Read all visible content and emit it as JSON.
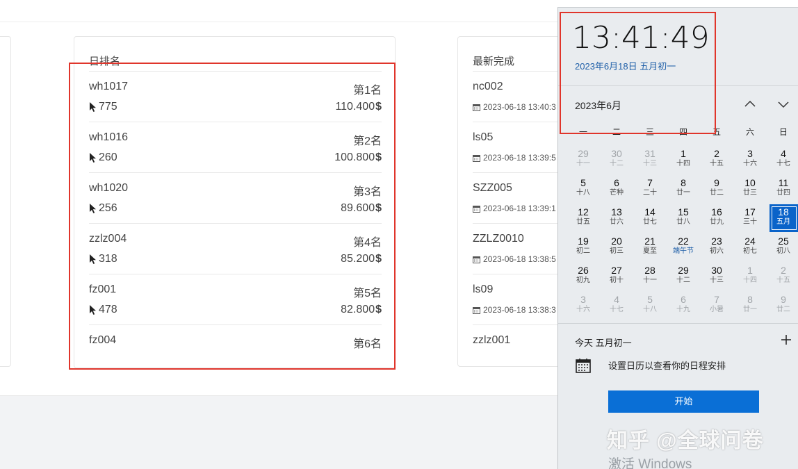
{
  "rank_card": {
    "title": "日排名",
    "items": [
      {
        "name": "wh1017",
        "place": "第1名",
        "clicks": "775",
        "amount": "110.400"
      },
      {
        "name": "wh1016",
        "place": "第2名",
        "clicks": "260",
        "amount": "100.800"
      },
      {
        "name": "wh1020",
        "place": "第3名",
        "clicks": "256",
        "amount": "89.600"
      },
      {
        "name": "zzlz004",
        "place": "第4名",
        "clicks": "318",
        "amount": "85.200"
      },
      {
        "name": "fz001",
        "place": "第5名",
        "clicks": "478",
        "amount": "82.800"
      },
      {
        "name": "fz004",
        "place": "第6名"
      }
    ],
    "currency_symbol": "$"
  },
  "latest_card": {
    "title": "最新完成",
    "items": [
      {
        "name": "nc002",
        "time": "2023-06-18 13:40:3"
      },
      {
        "name": "ls05",
        "time": "2023-06-18 13:39:5"
      },
      {
        "name": "SZZ005",
        "time": "2023-06-18 13:39:1"
      },
      {
        "name": "ZZLZ0010",
        "time": "2023-06-18 13:38:5"
      },
      {
        "name": "ls09",
        "time": "2023-06-18 13:38:3"
      },
      {
        "name": "zzlz001"
      }
    ]
  },
  "calendar": {
    "time": "13:41:49",
    "date": "2023年6月18日 五月初一",
    "month": "2023年6月",
    "weekdays": [
      "一",
      "二",
      "三",
      "四",
      "五",
      "六",
      "日"
    ],
    "days": [
      {
        "d": "29",
        "l": "十一",
        "other": true
      },
      {
        "d": "30",
        "l": "十二",
        "other": true
      },
      {
        "d": "31",
        "l": "十三",
        "other": true
      },
      {
        "d": "1",
        "l": "十四"
      },
      {
        "d": "2",
        "l": "十五"
      },
      {
        "d": "3",
        "l": "十六"
      },
      {
        "d": "4",
        "l": "十七"
      },
      {
        "d": "5",
        "l": "十八"
      },
      {
        "d": "6",
        "l": "芒种"
      },
      {
        "d": "7",
        "l": "二十"
      },
      {
        "d": "8",
        "l": "廿一"
      },
      {
        "d": "9",
        "l": "廿二"
      },
      {
        "d": "10",
        "l": "廿三"
      },
      {
        "d": "11",
        "l": "廿四"
      },
      {
        "d": "12",
        "l": "廿五"
      },
      {
        "d": "13",
        "l": "廿六"
      },
      {
        "d": "14",
        "l": "廿七"
      },
      {
        "d": "15",
        "l": "廿八"
      },
      {
        "d": "16",
        "l": "廿九"
      },
      {
        "d": "17",
        "l": "三十"
      },
      {
        "d": "18",
        "l": "五月",
        "today": true
      },
      {
        "d": "19",
        "l": "初二"
      },
      {
        "d": "20",
        "l": "初三"
      },
      {
        "d": "21",
        "l": "夏至"
      },
      {
        "d": "22",
        "l": "端午节",
        "fest": true
      },
      {
        "d": "23",
        "l": "初六"
      },
      {
        "d": "24",
        "l": "初七"
      },
      {
        "d": "25",
        "l": "初八"
      },
      {
        "d": "26",
        "l": "初九"
      },
      {
        "d": "27",
        "l": "初十"
      },
      {
        "d": "28",
        "l": "十一"
      },
      {
        "d": "29",
        "l": "十二"
      },
      {
        "d": "30",
        "l": "十三"
      },
      {
        "d": "1",
        "l": "十四",
        "other": true
      },
      {
        "d": "2",
        "l": "十五",
        "other": true
      },
      {
        "d": "3",
        "l": "十六",
        "other": true
      },
      {
        "d": "4",
        "l": "十七",
        "other": true
      },
      {
        "d": "5",
        "l": "十八",
        "other": true
      },
      {
        "d": "6",
        "l": "十九",
        "other": true
      },
      {
        "d": "7",
        "l": "小暑",
        "other": true
      },
      {
        "d": "8",
        "l": "廿一",
        "other": true
      },
      {
        "d": "9",
        "l": "廿二",
        "other": true
      }
    ],
    "today_label": "今天 五月初一",
    "agenda_text": "设置日历以查看你的日程安排",
    "start_button": "开始"
  },
  "watermark": "知乎 @全球问卷",
  "activate_text": "激活 Windows",
  "colors": {
    "highlight": "#e0352b",
    "accent": "#0a63c9",
    "date_link": "#1f5fa8"
  }
}
